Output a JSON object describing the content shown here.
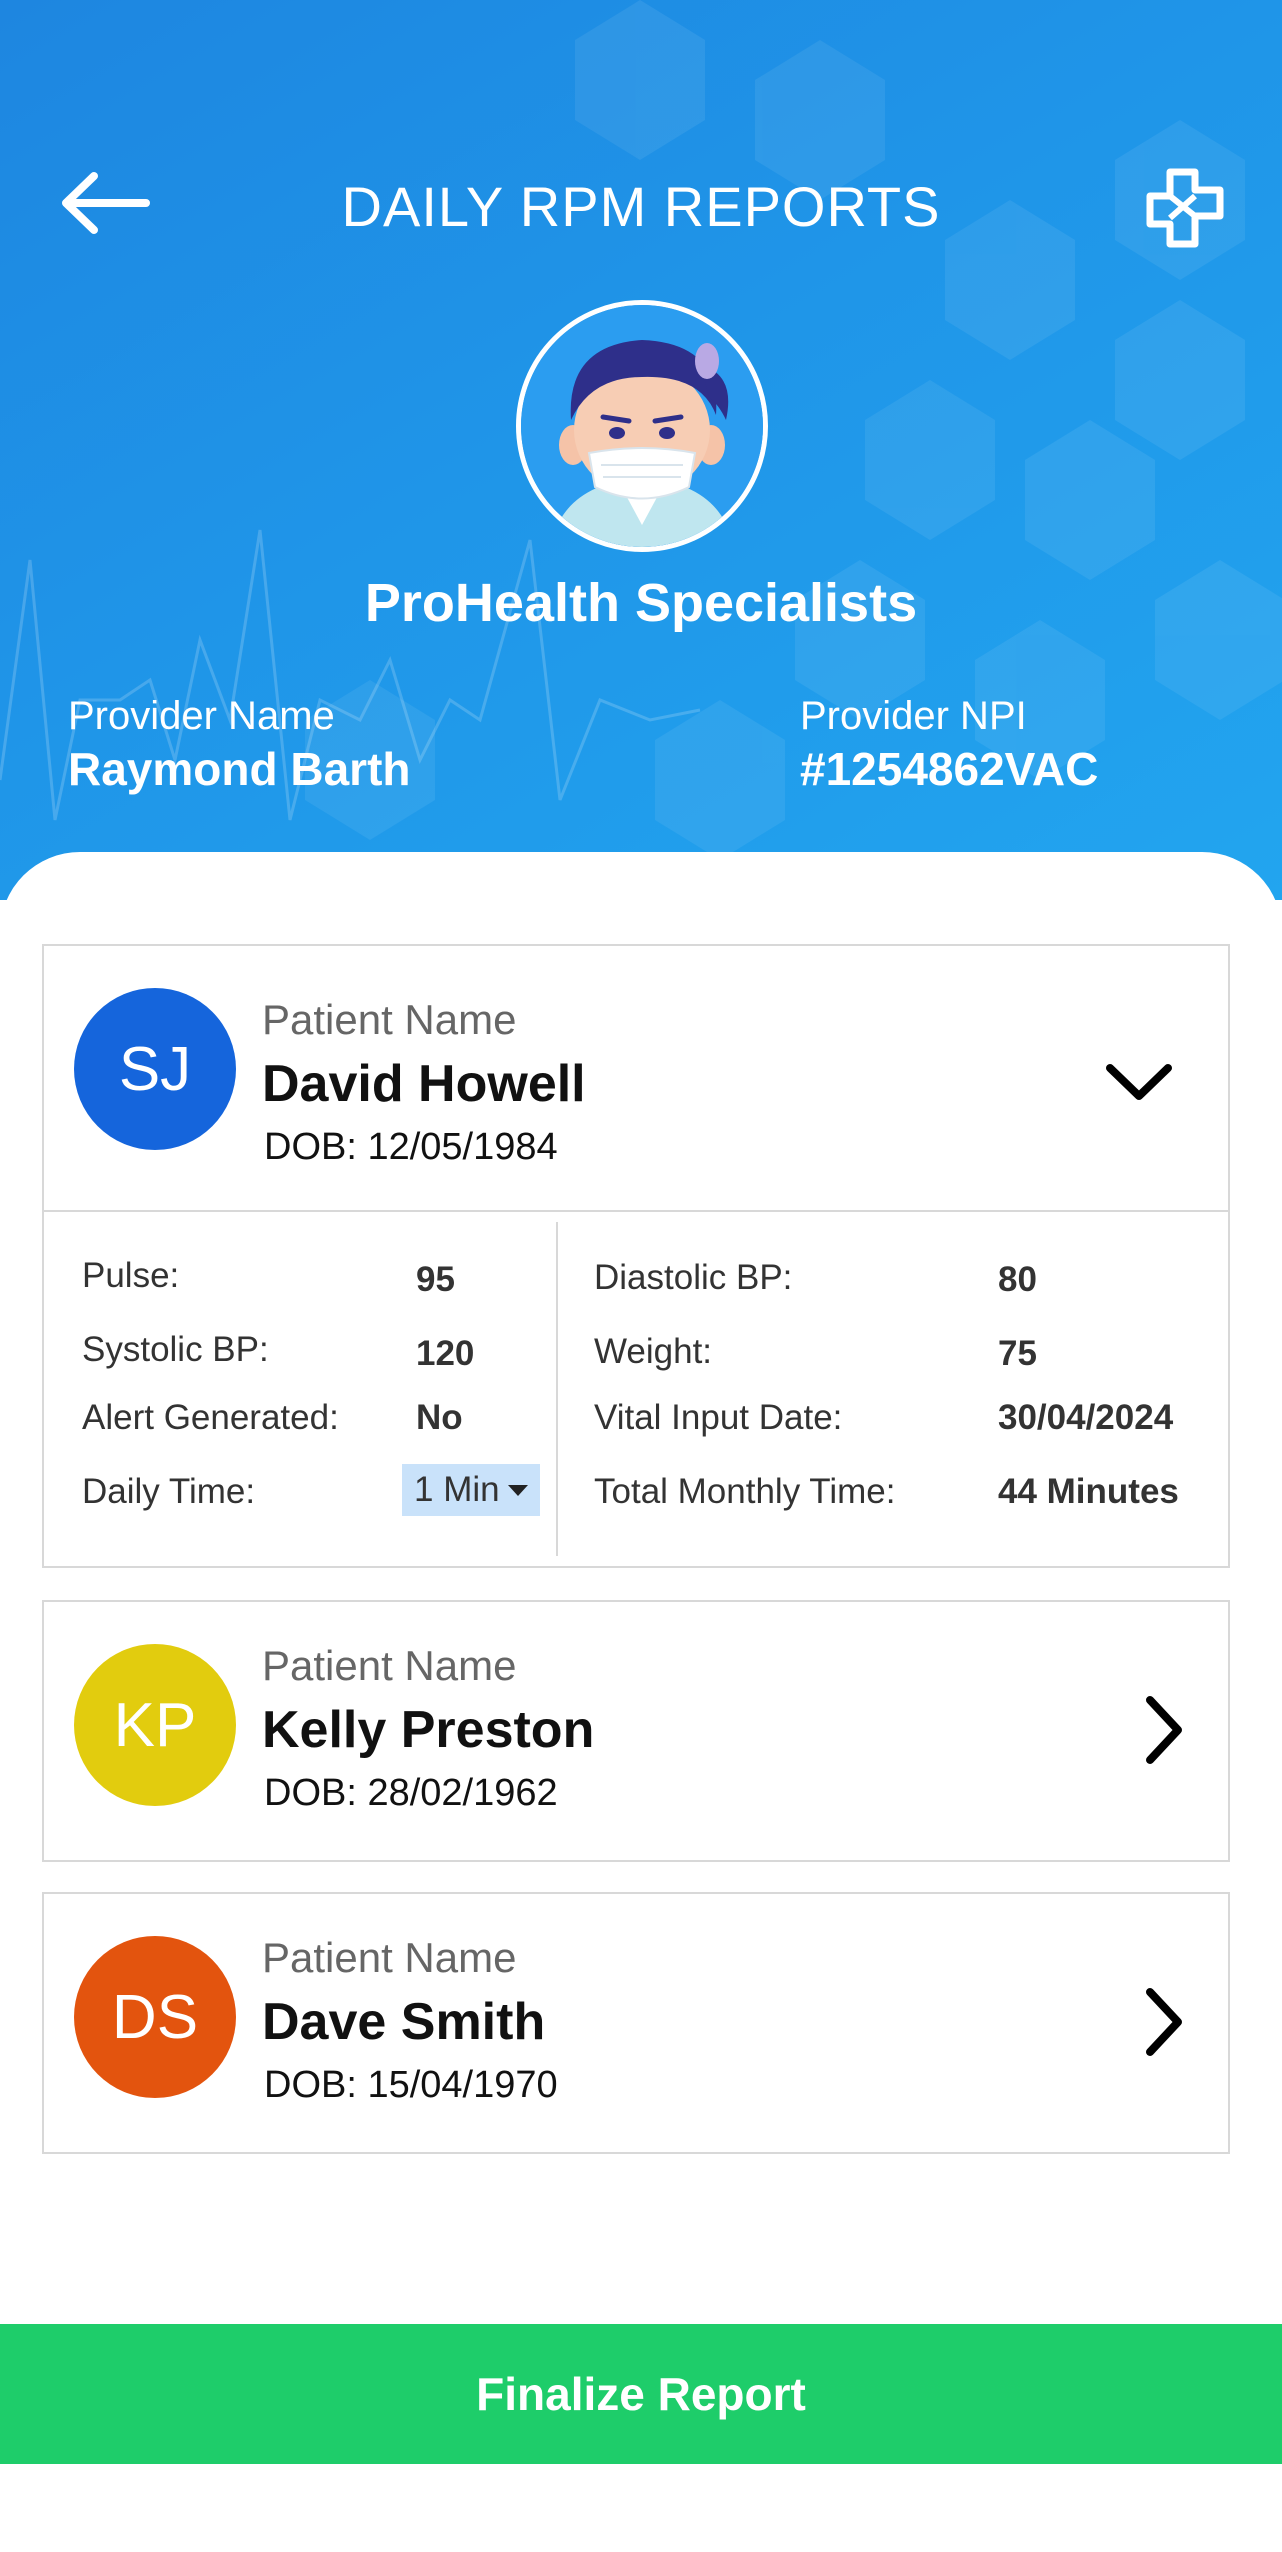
{
  "header": {
    "title": "DAILY RPM REPORTS",
    "org_name": "ProHealth Specialists",
    "provider_name_label": "Provider Name",
    "provider_name": "Raymond Barth",
    "provider_npi_label": "Provider NPI",
    "provider_npi": "#1254862VAC",
    "icons": {
      "back": "back-arrow-icon",
      "action": "medical-cross-icon",
      "avatar": "doctor-with-mask-avatar"
    }
  },
  "patients": [
    {
      "initials": "SJ",
      "label": "Patient Name",
      "name": "David Howell",
      "dob": "DOB: 12/05/1984",
      "color": "#1565dc",
      "expanded": true,
      "vitals_left": [
        {
          "label": "Pulse:",
          "value": "95"
        },
        {
          "label": "Systolic BP:",
          "value": "120"
        },
        {
          "label": "Alert Generated:",
          "value": "No"
        },
        {
          "label": "Daily Time:",
          "value": "1 Min"
        }
      ],
      "vitals_right": [
        {
          "label": "Diastolic BP:",
          "value": "80"
        },
        {
          "label": "Weight:",
          "value": "75"
        },
        {
          "label": "Vital Input Date:",
          "value": "30/04/2024"
        },
        {
          "label": "Total Monthly Time:",
          "value": "44 Minutes"
        }
      ]
    },
    {
      "initials": "KP",
      "label": "Patient Name",
      "name": "Kelly Preston",
      "dob": "DOB: 28/02/1962",
      "color": "#e2cc0e",
      "expanded": false
    },
    {
      "initials": "DS",
      "label": "Patient Name",
      "name": "Dave Smith",
      "dob": "DOB: 15/04/1970",
      "color": "#e3540e",
      "expanded": false
    }
  ],
  "footer": {
    "finalize_label": "Finalize Report",
    "color": "#1ecd6a"
  }
}
